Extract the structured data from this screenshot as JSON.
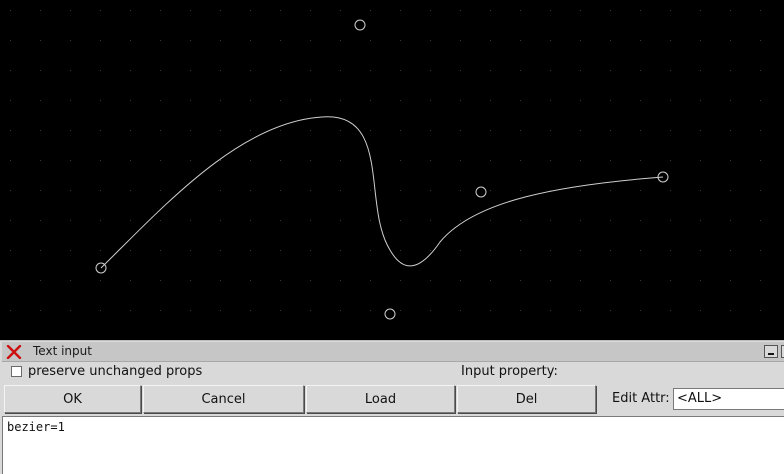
{
  "colors": {
    "canvas_background": "#000000",
    "grid_dot": "#3a3a3a",
    "curve_stroke": "#cfcfcf",
    "dialog_background": "#d9d9d9",
    "close_icon": "#cc1010"
  },
  "canvas": {
    "grid": true,
    "shape": "bezier-curve",
    "control_point_icon": "control-point-circle"
  },
  "dialog": {
    "title": "Text input",
    "title_icon": "x-close-icon",
    "preserve_checkbox": {
      "label": "preserve unchanged props",
      "checked": false
    },
    "input_property_label": "Input property:",
    "buttons": {
      "ok": "OK",
      "cancel": "Cancel",
      "load": "Load",
      "del": "Del"
    },
    "edit_attr": {
      "label": "Edit Attr:",
      "selected": "<ALL>"
    },
    "text_content": "bezier=1"
  }
}
